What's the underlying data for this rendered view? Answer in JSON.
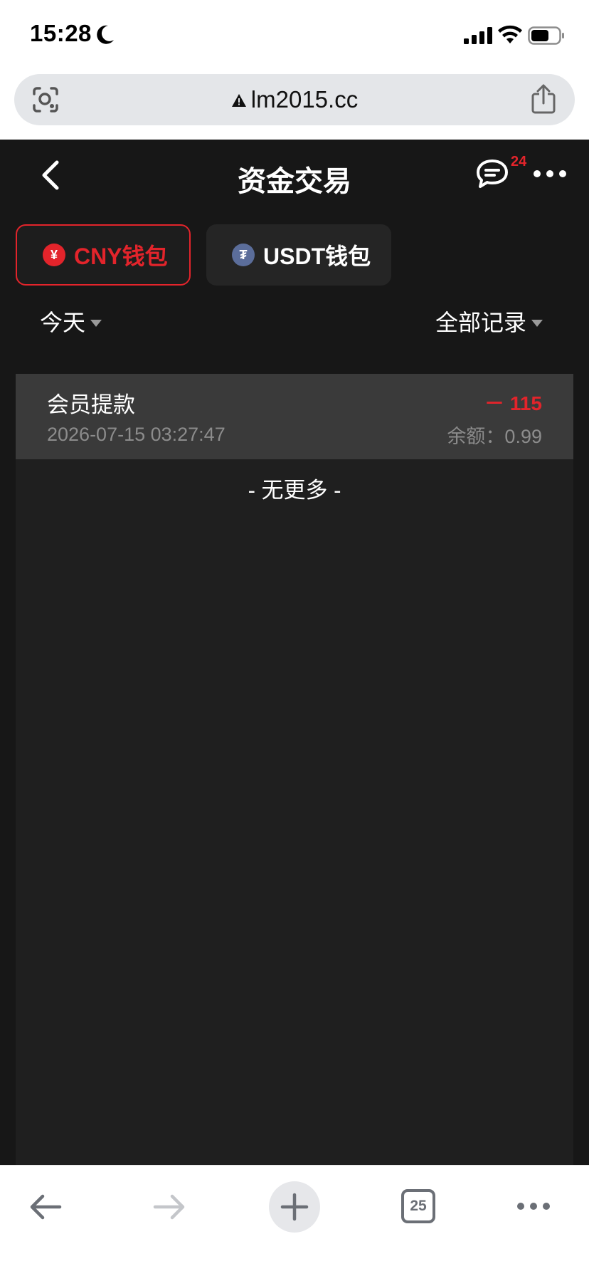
{
  "status_bar": {
    "time": "15:28"
  },
  "browser": {
    "url": "lm2015.cc",
    "tab_count": "25"
  },
  "header": {
    "title": "资金交易",
    "message_badge": "24"
  },
  "wallet_tabs": [
    {
      "label": "CNY钱包",
      "coin_glyph": "¥",
      "active": true
    },
    {
      "label": "USDT钱包",
      "coin_glyph": "₮",
      "active": false
    }
  ],
  "filters": {
    "date": "今天",
    "type": "全部记录"
  },
  "records": [
    {
      "title": "会员提款",
      "time": "2026-07-15 03:27:47",
      "amount": "－ 115",
      "balance": "余额：0.99"
    }
  ],
  "no_more_text": "- 无更多 -",
  "colors": {
    "accent": "#e3242b",
    "app_bg": "#171717",
    "panel_bg": "#1f1f1f",
    "row_bg": "#3a3a3a"
  },
  "icons": [
    "moon-icon",
    "signal-icon",
    "wifi-icon",
    "battery-icon",
    "lens-icon",
    "warning-icon",
    "share-icon",
    "back-arrow-icon",
    "chat-icon",
    "more-dots-icon",
    "yuan-coin-icon",
    "tether-coin-icon",
    "caret-down-icon",
    "browser-back-icon",
    "browser-forward-icon",
    "plus-icon",
    "tabs-icon",
    "browser-more-icon"
  ]
}
